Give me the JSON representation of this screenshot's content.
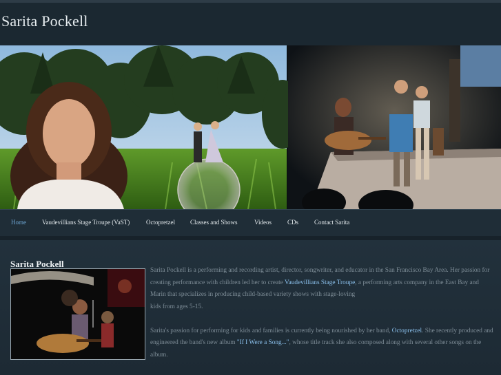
{
  "site": {
    "title": "Sarita Pockell"
  },
  "nav": {
    "items": [
      {
        "label": "Home",
        "active": true
      },
      {
        "label": "Vaudevillians Stage Troupe (VaST)"
      },
      {
        "label": "Octopretzel"
      },
      {
        "label": "Classes and Shows"
      },
      {
        "label": "Videos"
      },
      {
        "label": "CDs"
      },
      {
        "label": "Contact Sarita"
      }
    ]
  },
  "main": {
    "heading": "Sarita Pockell",
    "paragraph1": {
      "before": "Sarita Pockell is a performing and recording artist, director, songwriter, and educator in the San Francisco Bay Area.  Her passion for creating performance with children led her to create ",
      "link": "Vaudevillians Stage Troupe",
      "after": ", a performing arts company in the East Bay and Marin that specializes in producing child-based variety shows with stage-loving",
      "line2": "kids from ages 5-15."
    },
    "paragraph2": {
      "before": "Sarita's passion for performing for kids and families is currently being nourished by her band, ",
      "link1": "Octopretzel",
      "middle": ".  She recently produced and engineered the band's new album ",
      "link2": "\"If I Were a Song...\"",
      "after": ", whose title track she also composed along with several other songs on the album."
    }
  },
  "colors": {
    "background": "#1a2630",
    "nav_active": "#6fa8d6",
    "link": "#8cc2ee",
    "body_text": "#7f8e98"
  }
}
